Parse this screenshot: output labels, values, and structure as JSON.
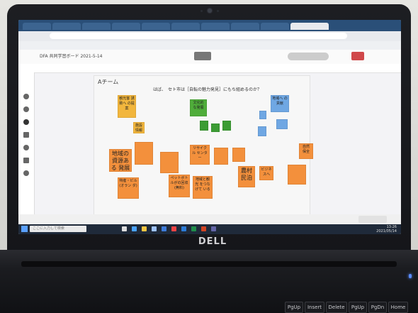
{
  "laptop": {
    "brand": "DELL"
  },
  "app": {
    "title": "DFA 共同学習ボード 2021-5-14"
  },
  "board": {
    "title": "Aチーム",
    "question": "はば、　セト市は［自転の魅力発見］にもち組めるのか？",
    "notes": [
      {
        "text": "観光客 誘致へ の提案",
        "color": "#f2b63d",
        "big": false
      },
      {
        "text": "文化的 な発展",
        "color": "#4fad3a",
        "big": false
      },
      {
        "text": "施設 情報",
        "color": "#f2b63d",
        "big": false
      },
      {
        "text": "地域の 資源ある 発展",
        "color": "#f3903c",
        "big": true
      },
      {
        "text": "農村 民泊",
        "color": "#f3903c",
        "big": true
      },
      {
        "text": "自然 保全",
        "color": "#f3903c",
        "big": false
      },
      {
        "text": "地域へ の貢献",
        "color": "#6fa7e3",
        "big": false
      },
      {
        "text": "リサイクル センター",
        "color": "#f3903c",
        "big": false
      },
      {
        "text": "地域と観光 をつなげて いる",
        "color": "#f3903c",
        "big": false
      },
      {
        "text": "ペットボト ルがの回収 (無料)",
        "color": "#f3903c",
        "big": false
      },
      {
        "text": "特産・ビル (オラン ダ)",
        "color": "#f3903c",
        "big": false
      },
      {
        "text": "ビジネ スへ",
        "color": "#f3903c",
        "big": false
      }
    ]
  },
  "taskbar": {
    "search_placeholder": "ここに入力して検索",
    "time": "13:26",
    "date": "2021/05/14"
  },
  "keyboard": [
    "PgUp",
    "Insert",
    "Delete",
    "PgUp",
    "PgDn",
    "Home"
  ]
}
